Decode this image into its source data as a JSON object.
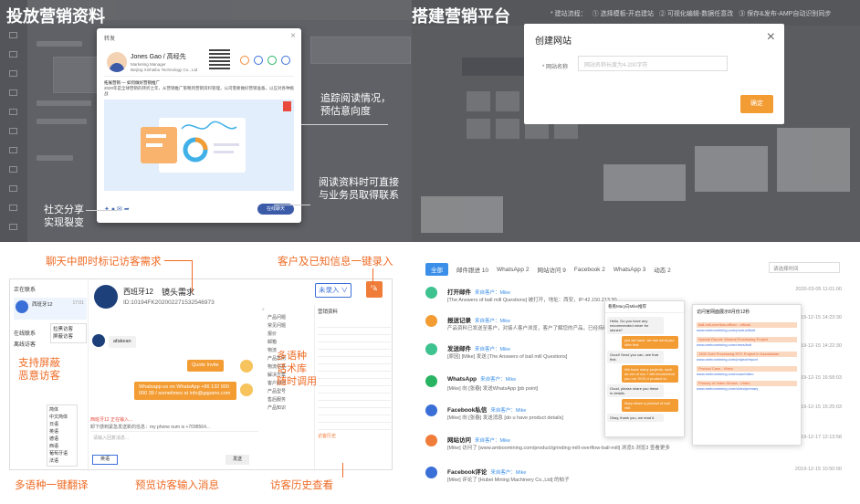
{
  "panels": {
    "top_left": {
      "title": "投放营销资料",
      "annotations": {
        "track": "追踪阅读情况，\n预估意向度",
        "contact": "阅读资料时可直接\n与业务员取得联系",
        "share": "社交分享\n实现裂变"
      },
      "modal": {
        "title": "转发",
        "name": "Jones Gao / 高经先",
        "role": "Marketing Manager\nBeijing Xinhaibu Technology Co., Ltd",
        "desc_title": "拓展营销 — 如何做好营销推广",
        "desc": "2020年是全球营销的转折之年，从营销推广策略到营销资料管理，公司需要做好营销准备，以应对各种挑战",
        "footer_btn": "在线聊天"
      }
    },
    "top_right": {
      "title": "搭建营销平台",
      "steps": [
        "* 建站流程：",
        "① 选择模板-开启建站",
        "② 可视化编辑-数据任意改",
        "③ 保存&发布-AMP自动识别同步"
      ],
      "create_modal": {
        "title": "创建网站",
        "label": "* 网站名称",
        "placeholder": "网站名称长度为4-200字符",
        "ok": "确定"
      }
    },
    "bottom_left": {
      "annotations": {
        "mark_needs": "聊天中即时标记访客需求",
        "one_click": "客户及已知信息一键录入",
        "block": "支持屏蔽\n恶意访客",
        "multi_lang": "多语种\n话术库\n随时调用",
        "translate": "多语种一键翻译",
        "preview": "预览访客输入消息",
        "history": "访客历史查看"
      },
      "chat": {
        "tab_active": "正在联系",
        "visitor": "西班牙12",
        "visitor_time": "17:01",
        "online": "在线联系",
        "blocked": "离线访客",
        "menu_block": "拉黑访客",
        "menu_remark": "屏蔽访客",
        "header_name": "西班牙12",
        "header_tag": "镜头需求",
        "header_id": "ID:10194FK202002271532546973",
        "record_btn": "未录入 ∨",
        "msg_visitor": "afakean",
        "msg_agent1": "Quote Invite",
        "msg_agent2": "Whatsapp us on WhatsApp +86 132 000 000 39 / sometimes at info@gqpano.com",
        "preview_label": "西班牙12 正在输入...",
        "preview_text": "卸下感到紧急发送新的信息：my phone num is +7098564...",
        "input_placeholder": "请输入回复消息...",
        "lang_select": "英语",
        "send_btn": "发送",
        "lang_options": [
          "简体",
          "中文简体",
          "日语",
          "英语",
          "德语",
          "西语",
          "葡萄牙语",
          "法语"
        ],
        "scripts": [
          "产品问题",
          "常见问题",
          "报价",
          "邮箱",
          "物流",
          "产品案例",
          "物流信息",
          "解决方案",
          "客户服务",
          "产品型号",
          "售后服务",
          "产品知识"
        ],
        "history_label": "访客历史",
        "info_title": "营销资料"
      }
    },
    "bottom_right": {
      "tabs": [
        "全部",
        "邮件跟进 10",
        "WhatsApp 2",
        "网站访问 9",
        "Facebook 2",
        "WhatsApp 3",
        "动态 2"
      ],
      "filter": "请选择时间",
      "feed": [
        {
          "type": "打开邮件",
          "who": "来自客户：Mike",
          "body": "[The Answers of ball mill Questions] 被打开，地址：西安，IP:42.150.213.30",
          "time": "2020-03-05 11:01:00",
          "color": "#3ec28f"
        },
        {
          "type": "报送记录",
          "who": "来自客户：Mike",
          "body": "产品资料已发送至客户，对接人客户浏览，客户了解您的产品，已经持续有效跟进",
          "time": "2019-12-15 14:23:30",
          "color": "#f39c33"
        },
        {
          "type": "发送邮件",
          "who": "来自客户：Mike",
          "body": "[原因]  [Mike] 发送  [The Answers of ball mill Questions]",
          "time": "2019-12-15 14:22:30",
          "color": "#3ec28f"
        },
        {
          "type": "WhatsApp",
          "who": "来自客户：Mike",
          "body": "[Mike] 向 [张春] 发送WhatsApp [pb point]",
          "time": "2019-12-15 16:58:03",
          "color": "#28b463"
        },
        {
          "type": "Facebook私信",
          "who": "来自客户：Mike",
          "body": "[Mike] 向 [张春] 发送消息 [do u have product details]",
          "time": "2019-12-15 15:25:03",
          "color": "#3b6fd8"
        },
        {
          "type": "网站访问",
          "who": "来自客户：Mike",
          "body": "[Mike] 访问了 [www.amboomining.com/product/grinding-mill-overflow-ball-mill]  浏览5    浏览3   查看更多",
          "time": "2019-12-17 12:13:58",
          "color": "#f07c3a"
        },
        {
          "type": "Facebook评论",
          "who": "来自客户：Mike",
          "body": "[Mike] 评论了 [Hubei Mining Machinery Co.,Ltd] 的帖子",
          "time": "2019-12-15 10:50:00",
          "color": "#3b6fd8"
        }
      ],
      "phone1": {
        "title": "看看Mary向Mike推荐",
        "messages": [
          "Hello. Do you have any recommended mixer for stones?",
          "yes we have. we can send you offer first",
          "Good! Send you can, see that first.",
          "We have many projects, such as xxx of xxx. I will recommend you our 3Y/D-4 product to.",
          "Good, please share you these in details.",
          "Mary share a product of ball mill.",
          "Okay, thank you, we read it."
        ]
      },
      "phone2": {
        "title": "访问官网面展示8月份12秒",
        "links": [
          "ball-mill-overflow-officer - official",
          "www.amboomining.com/product/bolt",
          "Special Report: Mineral Processing Project",
          "www.amboomining.com/news/bolt",
          "1300 Gold Processing EPC Project in Kazakhstan",
          "www.amboomining.com/project/report",
          "Product Case - Video",
          "www.amboomining.com/case/video",
          "Primary of Video Shows - Video",
          "www.amboomining.com/video/primary"
        ]
      }
    }
  }
}
